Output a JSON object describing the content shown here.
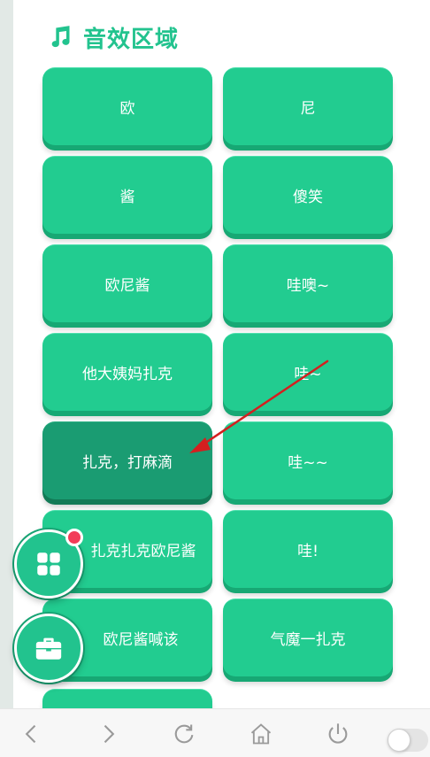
{
  "section": {
    "title": "音效区域",
    "icon": "music-note-icon"
  },
  "buttons": [
    {
      "label": "欧"
    },
    {
      "label": "尼"
    },
    {
      "label": "酱"
    },
    {
      "label": "傻笑"
    },
    {
      "label": "欧尼酱"
    },
    {
      "label": "哇噢~"
    },
    {
      "label": "他大姨妈扎克"
    },
    {
      "label": "哇~"
    },
    {
      "label": "扎克，打麻滴",
      "state": "pressed"
    },
    {
      "label": "哇~~"
    },
    {
      "label": "扎克扎克欧尼酱"
    },
    {
      "label": "哇!"
    },
    {
      "label": "欧尼酱喊该"
    },
    {
      "label": "气魔一扎克"
    }
  ],
  "fabs": [
    {
      "icon": "grid-apps-icon",
      "has_badge": true
    },
    {
      "icon": "toolbox-icon"
    }
  ],
  "bottom_nav": [
    "back-icon",
    "forward-icon",
    "refresh-icon",
    "home-icon",
    "power-icon",
    "toggle-switch"
  ],
  "colors": {
    "accent": "#22cc90",
    "accent_dark": "#17a874",
    "pressed": "#1a9c72",
    "badge": "#f23c58",
    "arrow": "#d41f1f"
  }
}
